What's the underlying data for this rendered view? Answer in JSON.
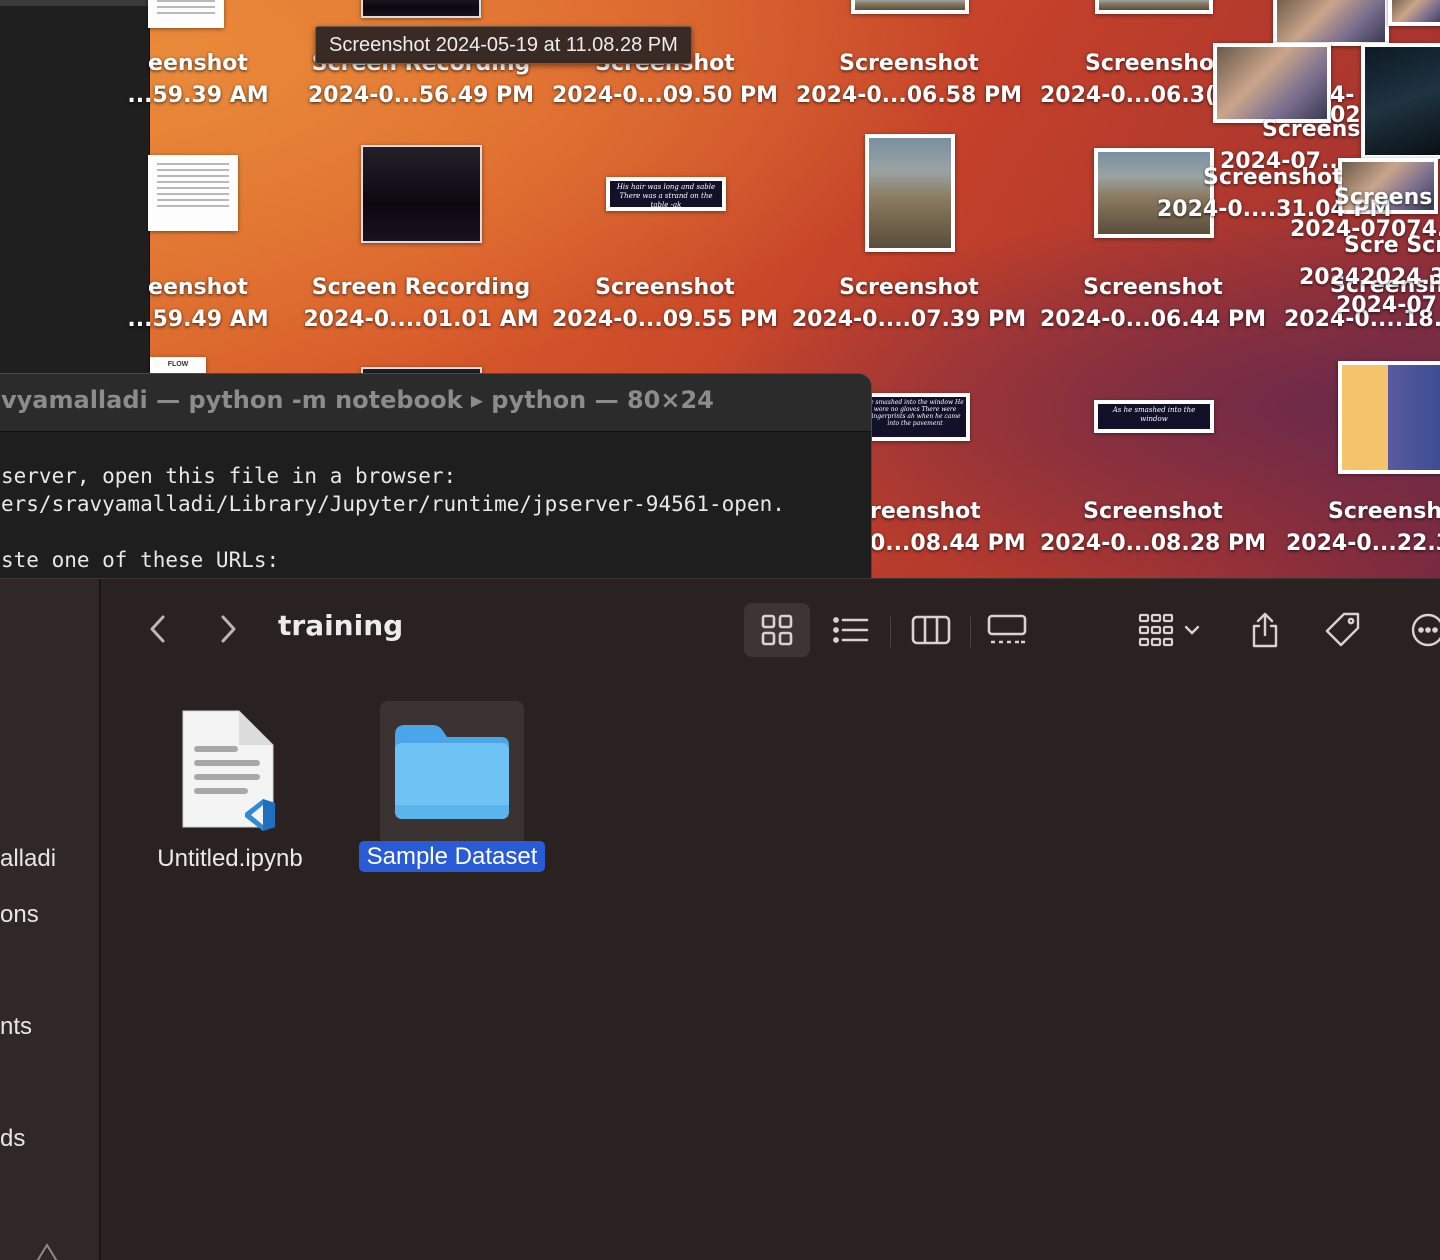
{
  "desktop": {
    "icons_row1": [
      {
        "name": "eenshot",
        "date": "...59.39 AM"
      },
      {
        "name": "Screen Recording",
        "date": "2024-0...56.49 PM"
      },
      {
        "name": "Screenshot",
        "date": "2024-0...09.50 PM"
      },
      {
        "name": "Screenshot",
        "date": "2024-0...06.58 PM"
      },
      {
        "name": "Screensho",
        "date": "2024-0...06.3("
      }
    ],
    "icons_row2": [
      {
        "name": "eenshot",
        "date": "...59.49 AM"
      },
      {
        "name": "Screen Recording",
        "date": "2024-0....01.01 AM"
      },
      {
        "name": "Screenshot",
        "date": "2024-0...09.55 PM"
      },
      {
        "name": "Screenshot",
        "date": "2024-0....07.39 PM"
      },
      {
        "name": "Screenshot",
        "date": "2024-0...06.44 PM"
      },
      {
        "name": "",
        "date": "2024-0....18."
      }
    ],
    "icons_row3": [
      {
        "name": "reenshot",
        "date": "0...08.44 PM"
      },
      {
        "name": "Screenshot",
        "date": "2024-0...08.28 PM"
      },
      {
        "name": "Screensh",
        "date": "2024-0...22.3"
      }
    ],
    "stacked_labels": [
      "4-",
      "02",
      "Screens",
      "2024-07..",
      "Screenshot",
      "2024-0....31.04 PM",
      "Screens",
      "2024-07074.",
      "Scre Scr",
      "Screensh",
      "20242024.3",
      "2024-07"
    ],
    "quote_texts": [
      "His hair was long and sable There was a strand on the table -ak",
      "he smashed into the window He wore no gloves There were fingerprints ah when he came into the pavement",
      "As he smashed into the window"
    ],
    "doc_label_flow": "FLOW"
  },
  "tooltip": {
    "text": "Screenshot 2024-05-19 at 11.08.28 PM"
  },
  "terminal": {
    "title": "vyamalladi — python -m notebook ▸ python — 80×24",
    "lines": [
      "server, open this file in a browser:",
      "ers/sravyamalladi/Library/Jupyter/runtime/jpserver-94561-open.",
      "",
      "ste one of these URLs:"
    ]
  },
  "finder": {
    "folder_title": "training",
    "sidebar_items": [
      "alladi",
      "ons",
      "nts",
      "ds"
    ],
    "files": [
      {
        "name": "Untitled.ipynb",
        "type": "notebook"
      },
      {
        "name": "Sample Dataset",
        "type": "folder",
        "selected": true
      }
    ],
    "accent": "#2a5bd6",
    "folder_color": "#6ec3f4"
  }
}
